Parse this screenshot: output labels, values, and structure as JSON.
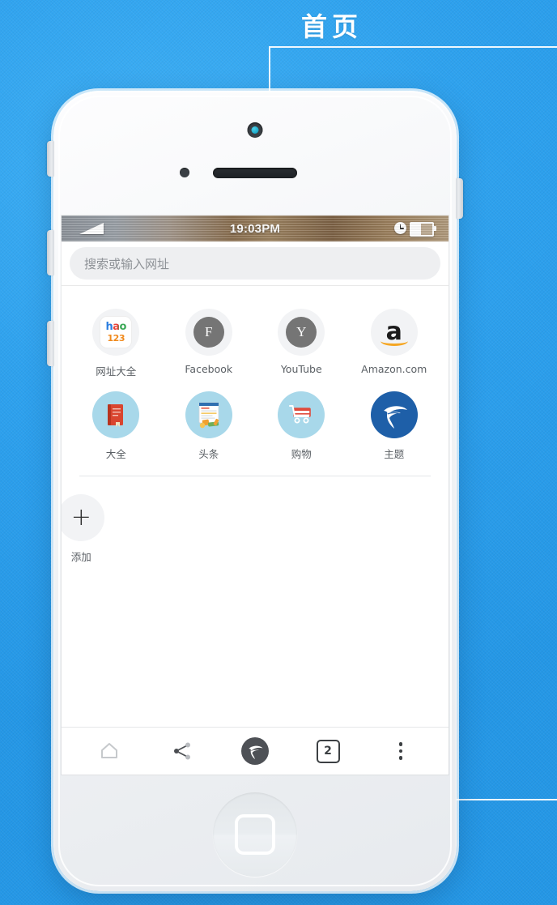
{
  "page": {
    "title": "首页"
  },
  "status_bar": {
    "time": "19:03PM",
    "signal_icon": "signal-triangle-icon",
    "clock_icon": "clock-icon",
    "battery_icon": "battery-icon",
    "battery_level_percent": 45
  },
  "browser": {
    "url_bar": {
      "value": "",
      "placeholder": "搜索或输入网址"
    },
    "shortcuts_row1": [
      {
        "label": "网址大全",
        "icon": "hao123-icon",
        "icon_top": "hao",
        "icon_bottom": "123"
      },
      {
        "label": "Facebook",
        "icon": "facebook-icon",
        "letter": "F"
      },
      {
        "label": "YouTube",
        "icon": "youtube-icon",
        "letter": "Y"
      },
      {
        "label": "Amazon.com",
        "icon": "amazon-icon",
        "letter": "a"
      }
    ],
    "shortcuts_row2": [
      {
        "label": "大全",
        "icon": "book-icon"
      },
      {
        "label": "头条",
        "icon": "news-icon"
      },
      {
        "label": "购物",
        "icon": "shopping-cart-icon"
      },
      {
        "label": "主题",
        "icon": "theme-swirl-icon"
      }
    ],
    "add_shortcut": {
      "label": "添加",
      "icon": "plus-icon",
      "glyph": "+"
    },
    "toolbar": {
      "home_label": "home-icon",
      "share_label": "share-icon",
      "brand_label": "brand-logo-icon",
      "tab_count": "2",
      "menu_label": "more-menu-icon"
    }
  },
  "device": {
    "camera_icon": "front-camera-icon",
    "sensor_icon": "proximity-sensor-icon",
    "speaker_icon": "earpiece-speaker-icon",
    "home_button_icon": "home-button-icon"
  },
  "colors": {
    "backdrop_blue": "#2fa3ef",
    "accent_lightblue": "#a8d8ea",
    "theme_blue": "#1e5fa8",
    "amazon_orange": "#f5a623",
    "icon_gray": "#757575"
  }
}
